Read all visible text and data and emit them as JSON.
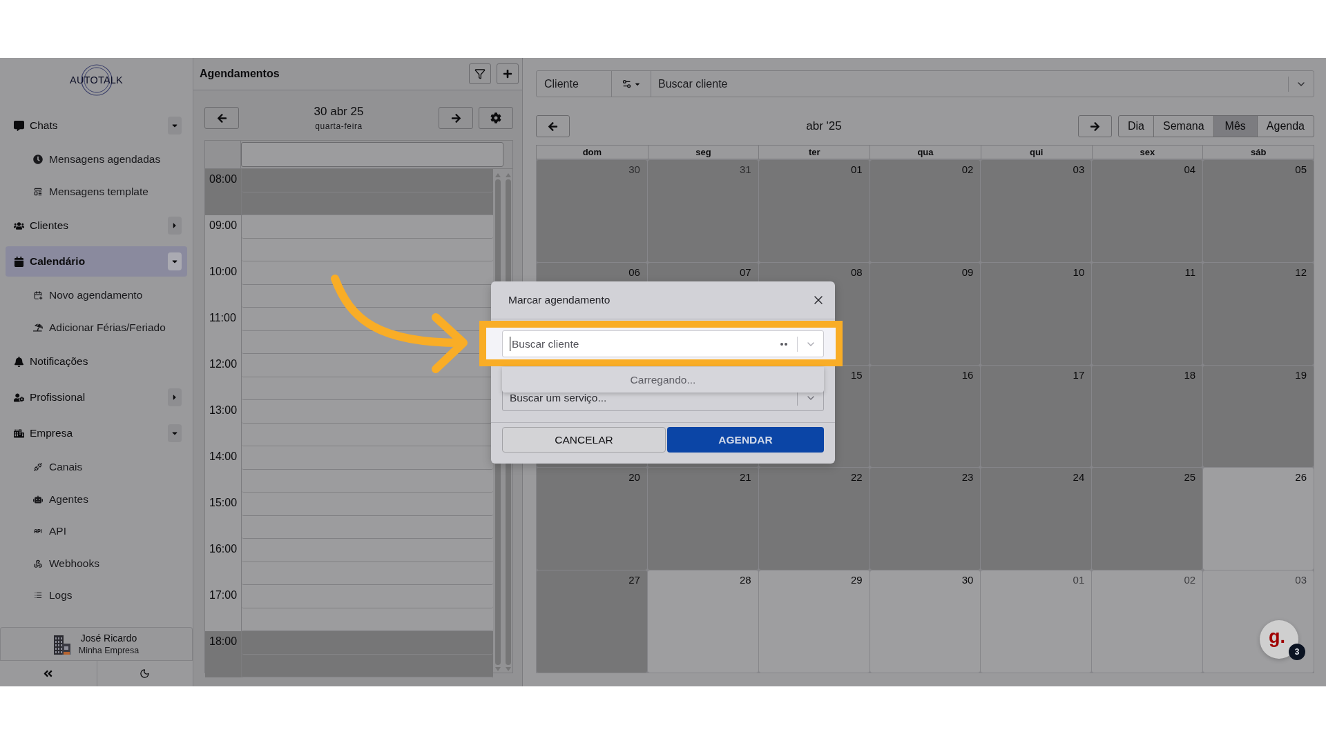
{
  "sidebar": {
    "logo": "AUTOTALK",
    "items": [
      {
        "kind": "group",
        "label": "Chats",
        "selected": false,
        "expanded": true,
        "children": [
          {
            "label": "Mensagens agendadas"
          },
          {
            "label": "Mensagens template"
          }
        ]
      },
      {
        "kind": "group",
        "label": "Clientes",
        "selected": false,
        "expanded": false
      },
      {
        "kind": "group",
        "label": "Calendário",
        "selected": true,
        "expanded": true,
        "children": [
          {
            "label": "Novo agendamento"
          },
          {
            "label": "Adicionar Férias/Feriado"
          }
        ]
      },
      {
        "kind": "link",
        "label": "Notificações",
        "selected": false
      },
      {
        "kind": "group",
        "label": "Profissional",
        "selected": false,
        "expanded": false
      },
      {
        "kind": "group",
        "label": "Empresa",
        "selected": false,
        "expanded": true,
        "children": [
          {
            "label": "Canais"
          },
          {
            "label": "Agentes"
          },
          {
            "label": "API"
          },
          {
            "label": "Webhooks"
          },
          {
            "label": "Logs"
          }
        ]
      }
    ],
    "user": {
      "name": "José Ricardo",
      "company": "Minha Empresa"
    }
  },
  "schedule": {
    "title": "Agendamentos",
    "date": "30 abr 25",
    "weekday": "quarta-feira",
    "hours": [
      {
        "label": "08:00",
        "closed": true
      },
      {
        "label": "09:00",
        "closed": false
      },
      {
        "label": "10:00",
        "closed": false
      },
      {
        "label": "11:00",
        "closed": false
      },
      {
        "label": "12:00",
        "closed": false
      },
      {
        "label": "13:00",
        "closed": false
      },
      {
        "label": "14:00",
        "closed": false
      },
      {
        "label": "15:00",
        "closed": false
      },
      {
        "label": "16:00",
        "closed": false
      },
      {
        "label": "17:00",
        "closed": false
      },
      {
        "label": "18:00",
        "closed": true
      }
    ]
  },
  "calendar": {
    "filter": {
      "label": "Cliente",
      "placeholder": "Buscar cliente"
    },
    "month": "abr '25",
    "views": [
      {
        "label": "Dia",
        "selected": false
      },
      {
        "label": "Semana",
        "selected": false
      },
      {
        "label": "Mês",
        "selected": true
      },
      {
        "label": "Agenda",
        "selected": false
      }
    ],
    "weekdays": [
      "dom",
      "seg",
      "ter",
      "qua",
      "qui",
      "sex",
      "sáb"
    ],
    "weeks": [
      [
        {
          "label": "30",
          "muted": true,
          "disabled": true
        },
        {
          "label": "31",
          "muted": true,
          "disabled": true
        },
        {
          "label": "01",
          "muted": false,
          "disabled": true
        },
        {
          "label": "02",
          "muted": false,
          "disabled": true
        },
        {
          "label": "03",
          "muted": false,
          "disabled": true
        },
        {
          "label": "04",
          "muted": false,
          "disabled": true
        },
        {
          "label": "05",
          "muted": false,
          "disabled": true
        }
      ],
      [
        {
          "label": "06",
          "muted": false,
          "disabled": true
        },
        {
          "label": "07",
          "muted": false,
          "disabled": true
        },
        {
          "label": "08",
          "muted": false,
          "disabled": true
        },
        {
          "label": "09",
          "muted": false,
          "disabled": true
        },
        {
          "label": "10",
          "muted": false,
          "disabled": true
        },
        {
          "label": "11",
          "muted": false,
          "disabled": true
        },
        {
          "label": "12",
          "muted": false,
          "disabled": true
        }
      ],
      [
        {
          "disabled": true
        },
        {
          "disabled": true
        },
        {
          "label": "15",
          "muted": false,
          "disabled": true
        },
        {
          "label": "16",
          "muted": false,
          "disabled": true
        },
        {
          "label": "17",
          "muted": false,
          "disabled": true
        },
        {
          "label": "18",
          "muted": false,
          "disabled": true
        },
        {
          "label": "19",
          "muted": false,
          "disabled": true
        }
      ],
      [
        {
          "label": "20",
          "muted": false,
          "disabled": true
        },
        {
          "label": "21",
          "muted": false,
          "disabled": true
        },
        {
          "label": "22",
          "muted": false,
          "disabled": true
        },
        {
          "label": "23",
          "muted": false,
          "disabled": true
        },
        {
          "label": "24",
          "muted": false,
          "disabled": true
        },
        {
          "label": "25",
          "muted": false,
          "disabled": true
        },
        {
          "label": "26",
          "muted": false,
          "disabled": false
        }
      ],
      [
        {
          "label": "27",
          "muted": false,
          "disabled": true
        },
        {
          "label": "28",
          "muted": false,
          "disabled": false
        },
        {
          "label": "29",
          "muted": false,
          "disabled": false
        },
        {
          "label": "30",
          "muted": false,
          "disabled": false
        },
        {
          "label": "01",
          "muted": true,
          "disabled": false
        },
        {
          "label": "02",
          "muted": true,
          "disabled": false
        },
        {
          "label": "03",
          "muted": true,
          "disabled": false
        }
      ]
    ]
  },
  "dialog": {
    "title": "Marcar agendamento",
    "client_field": {
      "placeholder": "Buscar cliente",
      "focused": true,
      "loading": true,
      "highlighted": true
    },
    "menu": {
      "message": "Carregando..."
    },
    "service_field": {
      "placeholder": "Buscar um serviço..."
    },
    "buttons": [
      {
        "label": "CANCELAR",
        "kind": "secondary"
      },
      {
        "label": "AGENDAR",
        "kind": "primary"
      }
    ]
  },
  "chat_widget": {
    "logo": "g.",
    "badge": "3"
  }
}
